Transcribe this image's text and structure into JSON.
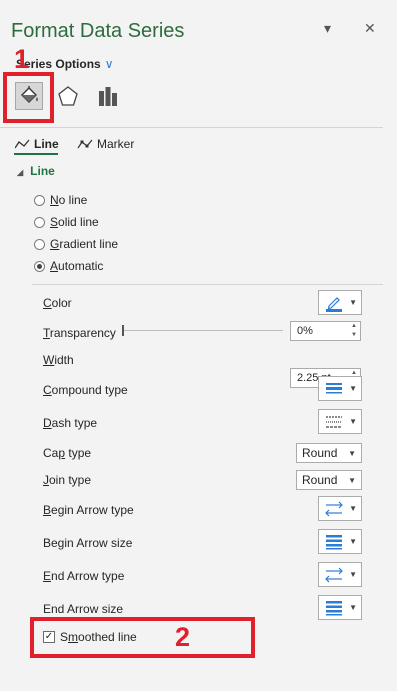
{
  "pane": {
    "title": "Format Data Series",
    "dropdown_glyph": "▾",
    "close_glyph": "✕"
  },
  "series_options": {
    "label": "Series Options",
    "chevron": "∨"
  },
  "tabs": [
    {
      "icon": "paint-bucket-icon",
      "active": true
    },
    {
      "icon": "pentagon-icon",
      "active": false
    },
    {
      "icon": "bar-chart-icon",
      "active": false
    }
  ],
  "subtabs": {
    "line": {
      "label": "Line",
      "active": true
    },
    "marker": {
      "label": "Marker"
    }
  },
  "section": {
    "label": "Line",
    "expanded_glyph": "◢"
  },
  "line_options": [
    {
      "id": "no-line",
      "first": "N",
      "rest": "o line",
      "checked": false
    },
    {
      "id": "solid-line",
      "first": "S",
      "rest": "olid line",
      "checked": false
    },
    {
      "id": "gradient-line",
      "first": "G",
      "rest": "radient line",
      "checked": false
    },
    {
      "id": "automatic",
      "first": "A",
      "rest": "utomatic",
      "checked": true
    }
  ],
  "properties": {
    "color": {
      "first": "C",
      "rest": "olor"
    },
    "transparency": {
      "first": "T",
      "rest": "ransparency",
      "value": "0%",
      "level": 0
    },
    "width": {
      "first": "W",
      "rest": "idth",
      "value": "2.25 pt"
    },
    "compound_type": {
      "first": "C",
      "rest": "ompound type"
    },
    "dash_type": {
      "first": "D",
      "rest": "ash type"
    },
    "cap_type": {
      "first": "Ca",
      "u": "p",
      "rest": " type",
      "value": "Round"
    },
    "join_type": {
      "first": "J",
      "rest": "oin type",
      "value": "Round"
    },
    "begin_arrow_type": {
      "first": "B",
      "rest": "egin Arrow type"
    },
    "begin_arrow_size": {
      "text": "Begin Arrow size"
    },
    "end_arrow_type": {
      "first": "E",
      "rest": "nd Arrow type"
    },
    "end_arrow_size": {
      "text": "End Arrow size"
    }
  },
  "smoothed_line": {
    "pre": "S",
    "u": "m",
    "rest": "oothed line",
    "checked": true,
    "check_glyph": "✓"
  },
  "annotations": {
    "label_1": "1",
    "label_2": "2"
  },
  "colors": {
    "accent_green": "#217346",
    "annotation_red": "#e0202a",
    "link_blue": "#2b7cd3"
  }
}
